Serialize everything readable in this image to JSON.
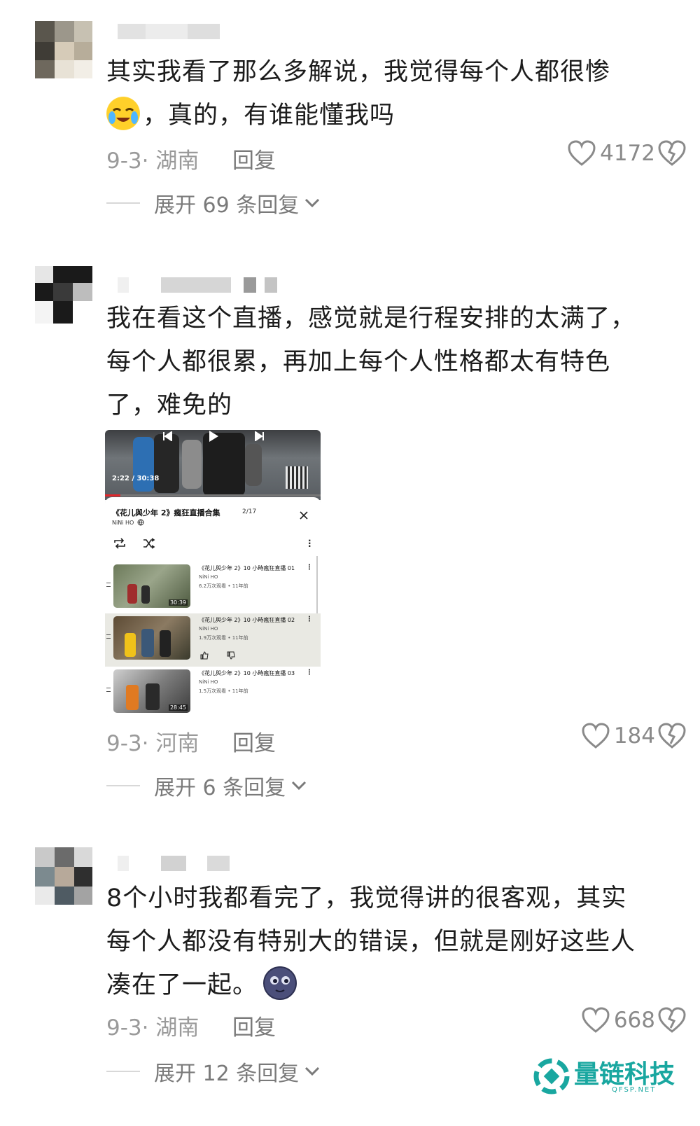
{
  "comments": [
    {
      "lines": [
        "其实我看了那么多解说，我觉得每个人都很惨",
        "，真的，有谁能懂我吗"
      ],
      "emoji": "crying-laughing-emoji",
      "date_location": "9-3· 湖南",
      "reply_label": "回复",
      "likes": "4172",
      "expand_label": "展开 69 条回复"
    },
    {
      "lines": [
        "我在看这个直播，感觉就是行程安排的太满了，",
        "每个人都很累，再加上每个人性格都太有特色",
        "了，难免的"
      ],
      "date_location": "9-3· 河南",
      "reply_label": "回复",
      "likes": "184",
      "expand_label": "展开 6 条回复",
      "embed": {
        "video_time": "2:22 / 30:38",
        "playlist_title": "《花儿與少年 2》瘋狂直播合集",
        "playlist_position": "2/17",
        "channel": "NiNi HO",
        "items": [
          {
            "title": "《花儿與少年 2》10 小時瘋狂直播 01",
            "channel": "NiNi HO",
            "meta": "6.2万次观看 • 11年前",
            "duration": "30:39"
          },
          {
            "title": "《花儿與少年 2》10 小時瘋狂直播 02",
            "channel": "NiNi HO",
            "meta": "1.9万次观看 • 11年前",
            "duration": ""
          },
          {
            "title": "《花儿與少年 2》10 小時瘋狂直播 03",
            "channel": "NiNi HO",
            "meta": "1.5万次观看 • 11年前",
            "duration": "28:45"
          }
        ]
      }
    },
    {
      "lines": [
        "8个小时我都看完了，我觉得讲的很客观，其实",
        "每个人都没有特别大的错误，但就是刚好这些人",
        "凑在了一起。"
      ],
      "emoji": "moon-face-emoji",
      "date_location": "9-3· 湖南",
      "reply_label": "回复",
      "likes": "668",
      "expand_label": "展开 12 条回复"
    }
  ],
  "watermark": {
    "name": "量链科技",
    "domain": "QFSP.NET"
  },
  "colors": {
    "text": "#1c1c1c",
    "meta": "#9a9a9a",
    "watermark": "#19a7a0"
  }
}
